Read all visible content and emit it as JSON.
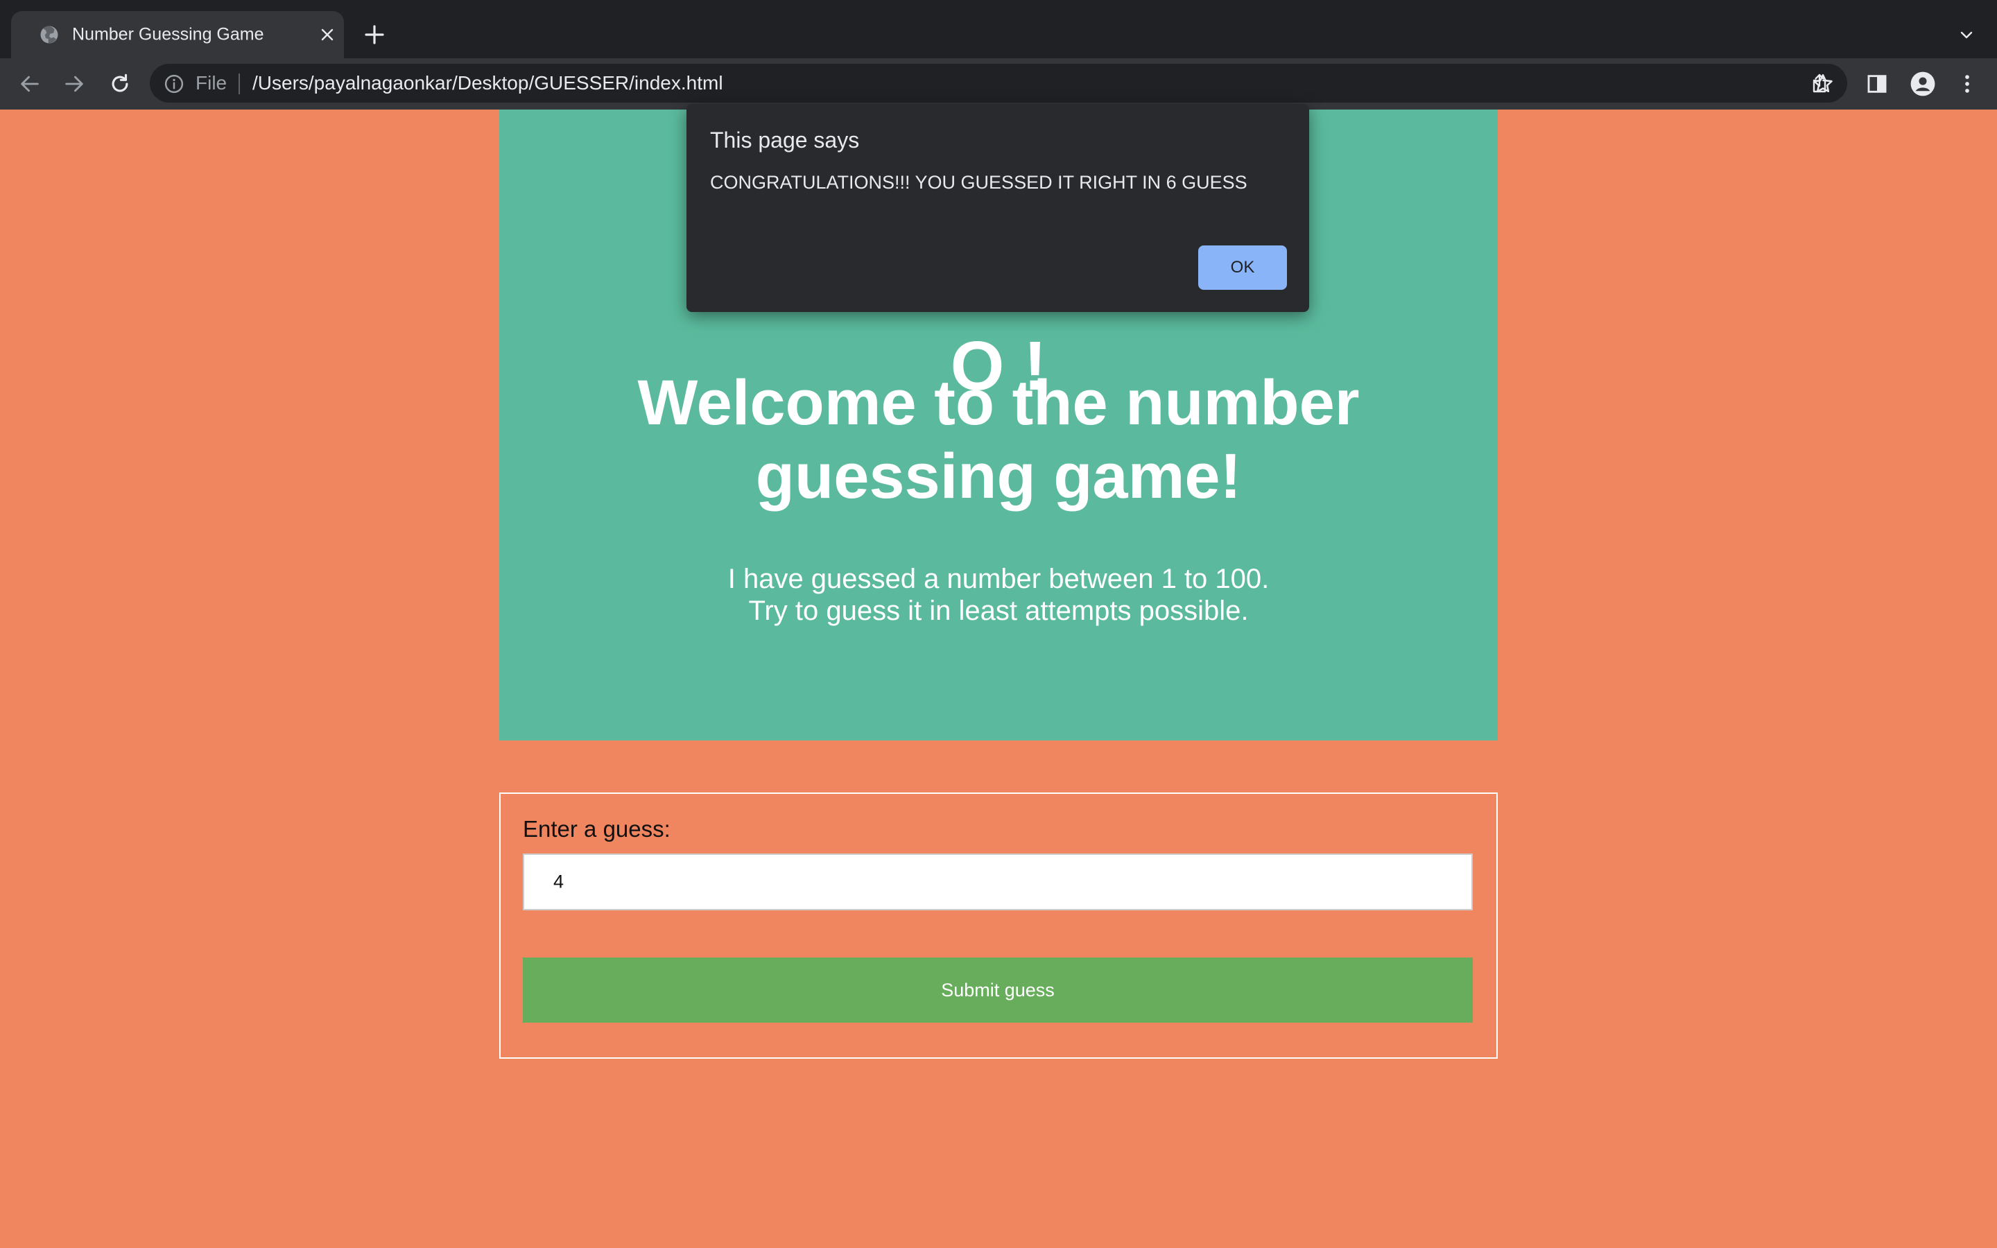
{
  "browser": {
    "tab_title": "Number Guessing Game",
    "omnibox": {
      "scheme_label": "File",
      "url": "/Users/payalnagaonkar/Desktop/GUESSER/index.html"
    },
    "icons": {
      "favicon": "globe-icon",
      "close": "close-icon",
      "new_tab": "plus-icon",
      "tab_list": "chevron-down-icon",
      "back": "back-arrow-icon",
      "forward": "forward-arrow-icon",
      "reload": "reload-icon",
      "site_info": "info-icon",
      "share": "share-icon",
      "bookmark": "star-icon",
      "side_panel": "side-panel-icon",
      "profile": "profile-icon",
      "menu": "kebab-menu-icon"
    }
  },
  "page": {
    "hero": {
      "partial_title": "O             !",
      "heading": "Welcome to the number guessing game!",
      "line1": "I have guessed a number between 1 to 100.",
      "line2": "Try to guess it in least attempts possible."
    },
    "form": {
      "label": "Enter a guess:",
      "input_value": "4",
      "submit_label": "Submit guess"
    }
  },
  "dialog": {
    "title": "This page says",
    "message": "CONGRATULATIONS!!! YOU GUESSED IT RIGHT IN 6 GUESS",
    "ok_label": "OK"
  },
  "colors": {
    "page_background": "#ef8660",
    "hero_background": "#5bba9d",
    "submit_button": "#68ad5c",
    "dialog_background": "#292a2d",
    "dialog_button": "#8ab4f8",
    "chrome_dark": "#202124",
    "chrome_toolbar": "#35363a"
  }
}
